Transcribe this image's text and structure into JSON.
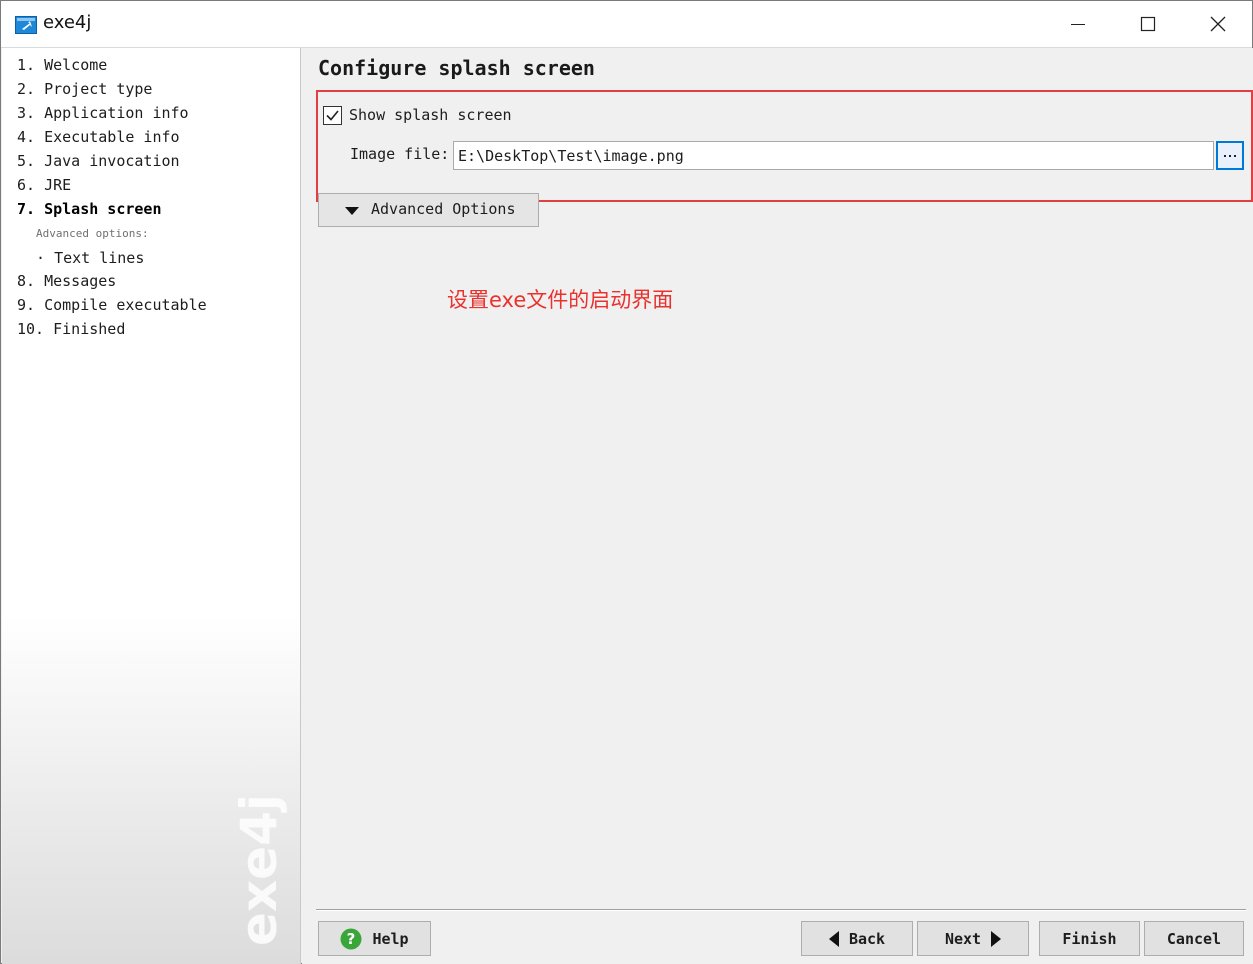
{
  "window": {
    "title": "exe4j"
  },
  "sidebar": {
    "steps": [
      {
        "num": "1.",
        "label": "Welcome"
      },
      {
        "num": "2.",
        "label": "Project type"
      },
      {
        "num": "3.",
        "label": "Application info"
      },
      {
        "num": "4.",
        "label": "Executable info"
      },
      {
        "num": "5.",
        "label": "Java invocation"
      },
      {
        "num": "6.",
        "label": "JRE"
      },
      {
        "num": "7.",
        "label": "Splash screen"
      },
      {
        "num": "8.",
        "label": "Messages"
      },
      {
        "num": "9.",
        "label": "Compile executable"
      },
      {
        "num": "10.",
        "label": "Finished"
      }
    ],
    "active_step": "Splash screen",
    "advanced_caption": "Advanced options:",
    "sub_items": [
      {
        "bullet": "·",
        "label": "Text lines"
      }
    ],
    "watermark": "exe4j"
  },
  "main": {
    "title": "Configure splash screen",
    "show_splash": {
      "label": "Show splash screen",
      "checked": true
    },
    "image_file": {
      "label": "Image file:",
      "value": "E:\\DeskTop\\Test\\image.png",
      "browse_label": "..."
    },
    "advanced_button": "Advanced Options",
    "annotation": "设置exe文件的启动界面"
  },
  "footer": {
    "help": "Help",
    "back": "Back",
    "next": "Next",
    "finish": "Finish",
    "cancel": "Cancel"
  },
  "colors": {
    "annotation": "#e8322e",
    "highlight_border": "#e04040",
    "focus_blue": "#0078d7",
    "help_green": "#3aa63a"
  },
  "icons": {
    "app": "exe4j-app-icon",
    "minimize": "minimize-icon",
    "maximize": "maximize-icon",
    "close": "close-icon",
    "checkbox": "checkmark-icon",
    "browse": "ellipsis-icon",
    "advanced": "triangle-down-icon",
    "help": "question-circle-icon",
    "back": "triangle-left-icon",
    "next": "triangle-right-icon"
  }
}
